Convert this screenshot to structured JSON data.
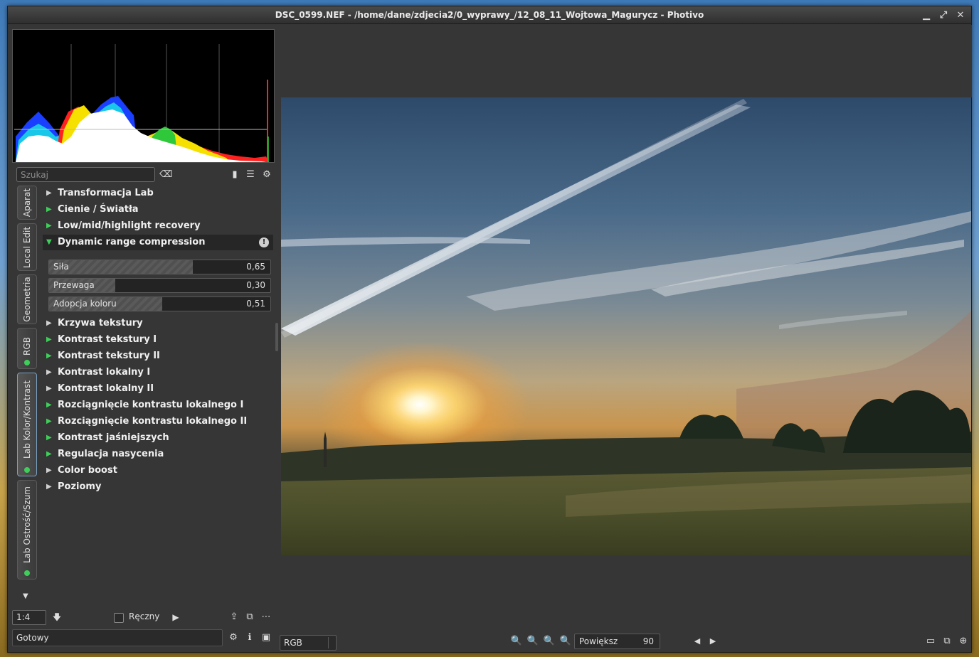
{
  "window": {
    "title": "DSC_0599.NEF - /home/dane/zdjecia2/0_wyprawy_/12_08_11_Wojtowa_Magurycz - Photivo",
    "minimize_glyph": "▁",
    "maximize_glyph": "⤢",
    "close_glyph": "✕"
  },
  "search": {
    "placeholder": "Szukaj",
    "clear_icon": "⌫",
    "bookmark_icon": "▮",
    "menu_icon": "☰",
    "settings_icon": "⚙"
  },
  "tabs": [
    {
      "label": "Aparat",
      "dot": false
    },
    {
      "label": "Local Edit",
      "dot": false
    },
    {
      "label": "Geometria",
      "dot": false
    },
    {
      "label": "RGB",
      "dot": true
    },
    {
      "label": "Lab Kolor/Kontrast",
      "dot": true,
      "active": true
    },
    {
      "label": "Lab Ostrość/Szum",
      "dot": true
    }
  ],
  "filters": [
    {
      "label": "Transformacja Lab"
    },
    {
      "label": "Cienie / Światła"
    },
    {
      "label": "Low/mid/highlight recovery"
    },
    {
      "label": "Dynamic range compression",
      "open": true
    },
    {
      "label": "Krzywa tekstury"
    },
    {
      "label": "Kontrast tekstury I"
    },
    {
      "label": "Kontrast tekstury II"
    },
    {
      "label": "Kontrast lokalny I"
    },
    {
      "label": "Kontrast lokalny II"
    },
    {
      "label": "Rozciągnięcie kontrastu lokalnego I"
    },
    {
      "label": "Rozciągnięcie kontrastu lokalnego II"
    },
    {
      "label": "Kontrast jaśniejszych"
    },
    {
      "label": "Regulacja nasycenia"
    },
    {
      "label": "Color boost"
    },
    {
      "label": "Poziomy"
    }
  ],
  "drc_info_icon": "!",
  "sliders": [
    {
      "label": "Siła",
      "value": "0,65",
      "fraction": 0.65
    },
    {
      "label": "Przewaga",
      "value": "0,30",
      "fraction": 0.3
    },
    {
      "label": "Adopcja koloru",
      "value": "0,51",
      "fraction": 0.51
    }
  ],
  "bottom": {
    "zoom_ratio": "1:4",
    "down_arrow_icon": "🡇",
    "manual_label": "Ręczny",
    "play_icon": "▶",
    "export_icon": "⇪",
    "batch_icon": "⧉",
    "more_icon": "⋯",
    "status": "Gotowy",
    "status_settings_icon": "⚙",
    "status_info_icon": "ℹ",
    "status_fullscreen_icon": "▣",
    "tabs_scroll_icon": "▼"
  },
  "view": {
    "channel": "RGB",
    "zoom_in_icon": "🔍",
    "zoom_out_icon": "🔍",
    "zoom_fit_icon": "🔍",
    "zoom_100_icon": "🔍",
    "zoom_label": "Powiększ",
    "zoom_value": "90",
    "prev_icon": "◀",
    "next_icon": "▶",
    "single_view_icon": "▭",
    "compare_view_icon": "⧉",
    "fullscreen_icon": "⊕"
  },
  "colors": {
    "accent_green": "#3ecf5a",
    "panel_bg": "#363636"
  }
}
